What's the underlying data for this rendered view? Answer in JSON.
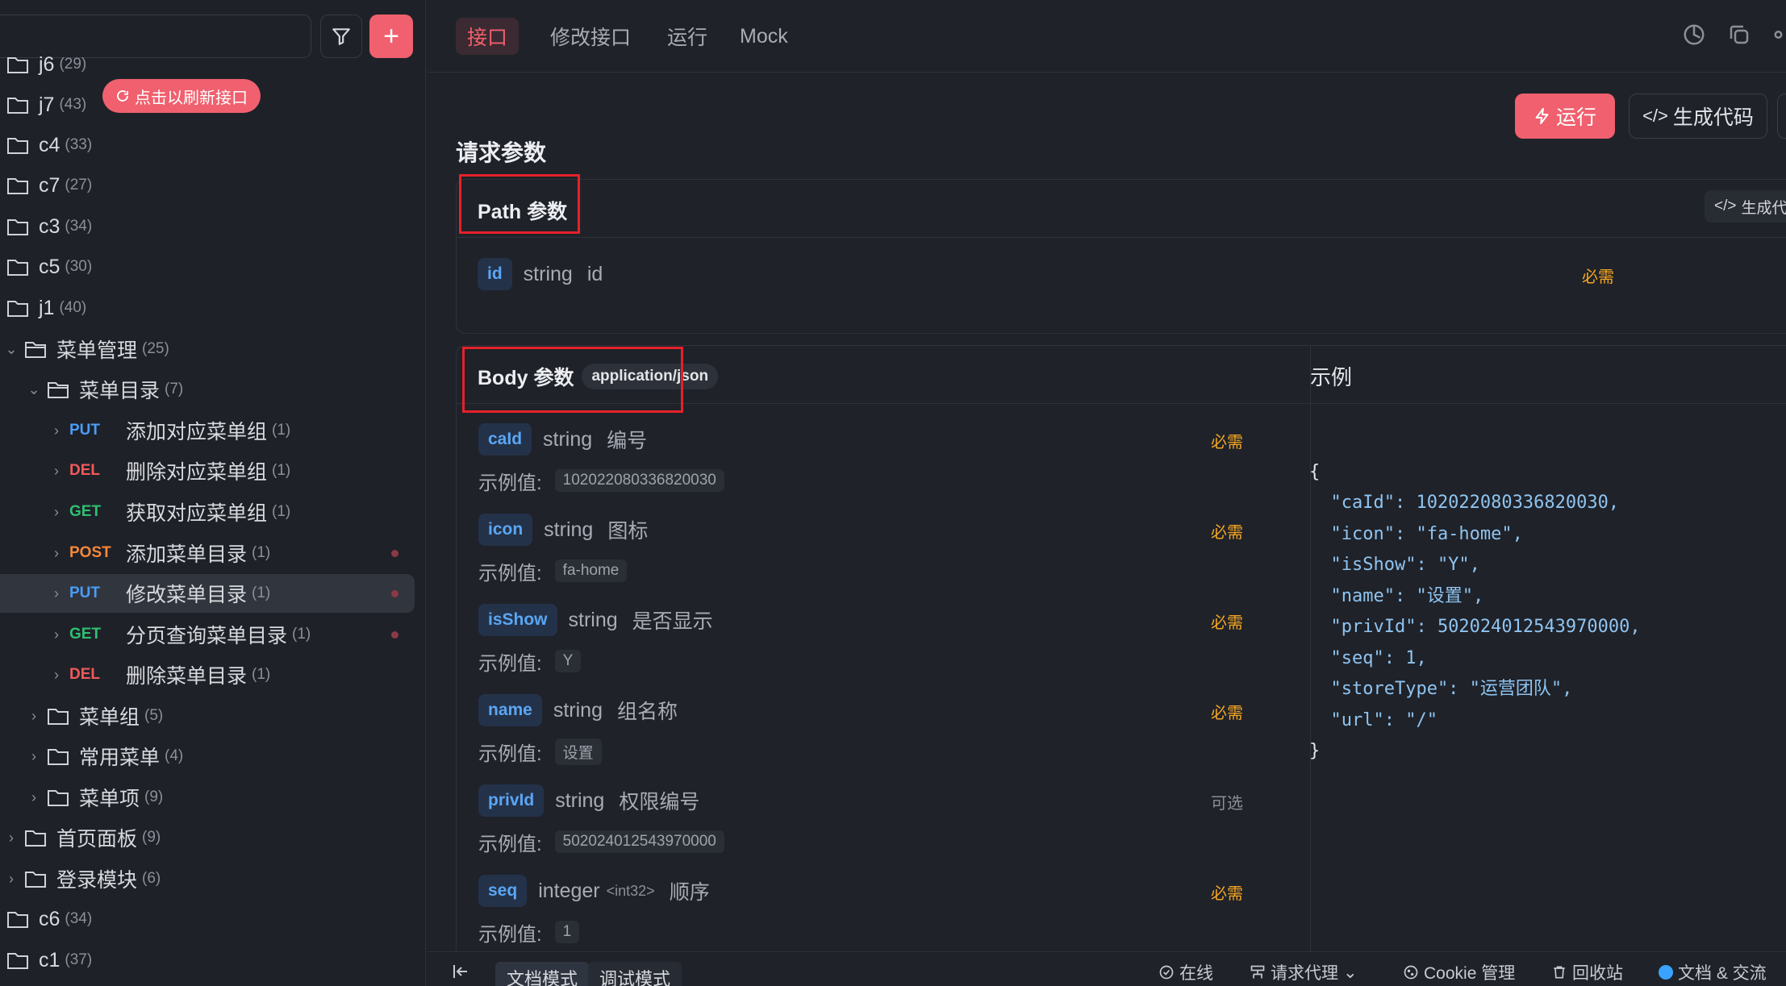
{
  "sidebar": {
    "refresh_label": "点击以刷新接口",
    "items": [
      {
        "label": "j6",
        "count": "(29)"
      },
      {
        "label": "j7",
        "count": "(43)"
      },
      {
        "label": "c4",
        "count": "(33)"
      },
      {
        "label": "c7",
        "count": "(27)"
      },
      {
        "label": "c3",
        "count": "(34)"
      },
      {
        "label": "c5",
        "count": "(30)"
      },
      {
        "label": "j1",
        "count": "(40)"
      },
      {
        "label": "菜单管理",
        "count": "(25)"
      },
      {
        "label": "菜单目录",
        "count": "(7)"
      },
      {
        "method": "PUT",
        "label": "添加对应菜单组",
        "count": "(1)"
      },
      {
        "method": "DEL",
        "label": "删除对应菜单组",
        "count": "(1)"
      },
      {
        "method": "GET",
        "label": "获取对应菜单组",
        "count": "(1)"
      },
      {
        "method": "POST",
        "label": "添加菜单目录",
        "count": "(1)"
      },
      {
        "method": "PUT",
        "label": "修改菜单目录",
        "count": "(1)"
      },
      {
        "method": "GET",
        "label": "分页查询菜单目录",
        "count": "(1)"
      },
      {
        "method": "DEL",
        "label": "删除菜单目录",
        "count": "(1)"
      },
      {
        "label": "菜单组",
        "count": "(5)"
      },
      {
        "label": "常用菜单",
        "count": "(4)"
      },
      {
        "label": "菜单项",
        "count": "(9)"
      },
      {
        "label": "首页面板",
        "count": "(9)"
      },
      {
        "label": "登录模块",
        "count": "(6)"
      },
      {
        "label": "c6",
        "count": "(34)"
      },
      {
        "label": "c1",
        "count": "(37)"
      }
    ]
  },
  "tabs": [
    "接口",
    "修改接口",
    "运行",
    "Mock"
  ],
  "actions": {
    "run": "运行",
    "generate_code": "生成代码",
    "generate_code_small": "生成代"
  },
  "section_title": "请求参数",
  "path_params": {
    "title": "Path 参数",
    "items": [
      {
        "name": "id",
        "type": "string",
        "desc": "id",
        "required": "必需"
      }
    ]
  },
  "body_params": {
    "title": "Body 参数",
    "mime": "application/json",
    "example_label": "示例值:",
    "items": [
      {
        "name": "caId",
        "type": "string",
        "format": "",
        "desc": "编号",
        "required": "必需",
        "example": "102022080336820030"
      },
      {
        "name": "icon",
        "type": "string",
        "format": "",
        "desc": "图标",
        "required": "必需",
        "example": "fa-home"
      },
      {
        "name": "isShow",
        "type": "string",
        "format": "",
        "desc": "是否显示",
        "required": "必需",
        "example": "Y"
      },
      {
        "name": "name",
        "type": "string",
        "format": "",
        "desc": "组名称",
        "required": "必需",
        "example": "设置"
      },
      {
        "name": "privId",
        "type": "string",
        "format": "",
        "desc": "权限编号",
        "required": "可选",
        "example": "502024012543970000"
      },
      {
        "name": "seq",
        "type": "integer",
        "format": "<int32>",
        "desc": "顺序",
        "required": "必需",
        "example": "1"
      }
    ]
  },
  "example": {
    "title": "示例",
    "lines": [
      "{",
      "  \"caId\": 102022080336820030,",
      "  \"icon\": \"fa-home\",",
      "  \"isShow\": \"Y\",",
      "  \"name\": \"设置\",",
      "  \"privId\": 502024012543970000,",
      "  \"seq\": 1,",
      "  \"storeType\": \"运营团队\",",
      "  \"url\": \"/\"",
      "}"
    ]
  },
  "bottom": {
    "doc_mode": "文档模式",
    "debug_mode": "调试模式",
    "online": "在线",
    "proxy": "请求代理",
    "cookie": "Cookie 管理",
    "recycle": "回收站",
    "docs": "文档 & 交流"
  },
  "colors": {
    "accent": "#f0606e",
    "required": "#f5a623",
    "put": "#4a9df8",
    "del": "#f05a5a",
    "get": "#2fbf71",
    "post": "#f5883a",
    "annotation": "#e5212a"
  }
}
